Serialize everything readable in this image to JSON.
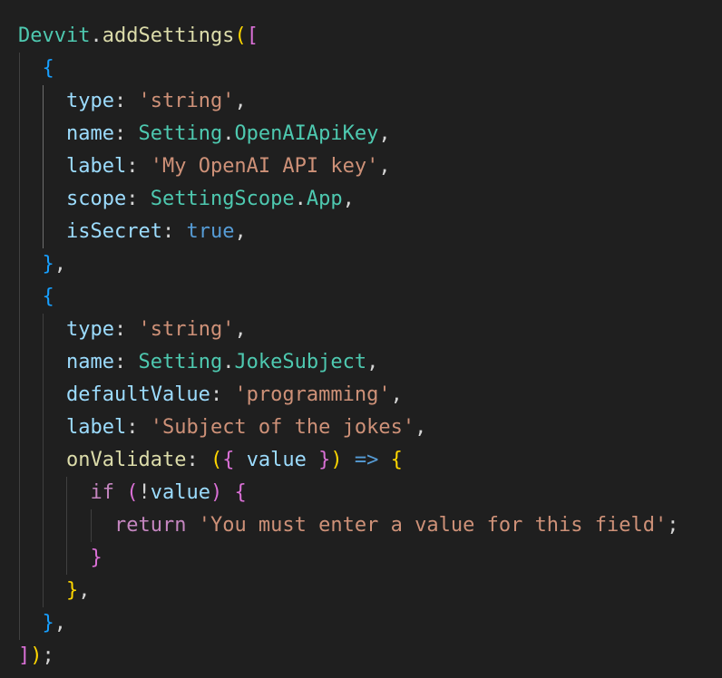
{
  "editor": {
    "language": "typescript",
    "theme": "dark",
    "colors": {
      "background": "#1f1f1f",
      "class": "#4ec9b0",
      "function": "#dcdcaa",
      "property": "#9cdcfe",
      "string": "#ce9178",
      "keyword": "#569cd6",
      "control": "#c586c0",
      "punctuation": "#d4d4d4",
      "bracket_level_1": "#ffd700",
      "bracket_level_2": "#da70d6",
      "bracket_level_3": "#179fff"
    },
    "lines": [
      [
        [
          "cls",
          "Devvit"
        ],
        [
          "punct",
          "."
        ],
        [
          "fn",
          "addSettings"
        ],
        [
          "b1",
          "("
        ],
        [
          "b2",
          "["
        ]
      ],
      [
        [
          "punct",
          "  "
        ],
        [
          "b3",
          "{"
        ]
      ],
      [
        [
          "punct",
          "    "
        ],
        [
          "prop",
          "type"
        ],
        [
          "punct",
          ": "
        ],
        [
          "str",
          "'string'"
        ],
        [
          "punct",
          ","
        ]
      ],
      [
        [
          "punct",
          "    "
        ],
        [
          "prop",
          "name"
        ],
        [
          "punct",
          ": "
        ],
        [
          "cls",
          "Setting"
        ],
        [
          "punct",
          "."
        ],
        [
          "cls",
          "OpenAIApiKey"
        ],
        [
          "punct",
          ","
        ]
      ],
      [
        [
          "punct",
          "    "
        ],
        [
          "prop",
          "label"
        ],
        [
          "punct",
          ": "
        ],
        [
          "str",
          "'My OpenAI API key'"
        ],
        [
          "punct",
          ","
        ]
      ],
      [
        [
          "punct",
          "    "
        ],
        [
          "prop",
          "scope"
        ],
        [
          "punct",
          ": "
        ],
        [
          "cls",
          "SettingScope"
        ],
        [
          "punct",
          "."
        ],
        [
          "cls",
          "App"
        ],
        [
          "punct",
          ","
        ]
      ],
      [
        [
          "punct",
          "    "
        ],
        [
          "prop",
          "isSecret"
        ],
        [
          "punct",
          ": "
        ],
        [
          "kw",
          "true"
        ],
        [
          "punct",
          ","
        ]
      ],
      [
        [
          "punct",
          "  "
        ],
        [
          "b3",
          "}"
        ],
        [
          "punct",
          ","
        ]
      ],
      [
        [
          "punct",
          "  "
        ],
        [
          "b3",
          "{"
        ]
      ],
      [
        [
          "punct",
          "    "
        ],
        [
          "prop",
          "type"
        ],
        [
          "punct",
          ": "
        ],
        [
          "str",
          "'string'"
        ],
        [
          "punct",
          ","
        ]
      ],
      [
        [
          "punct",
          "    "
        ],
        [
          "prop",
          "name"
        ],
        [
          "punct",
          ": "
        ],
        [
          "cls",
          "Setting"
        ],
        [
          "punct",
          "."
        ],
        [
          "cls",
          "JokeSubject"
        ],
        [
          "punct",
          ","
        ]
      ],
      [
        [
          "punct",
          "    "
        ],
        [
          "prop",
          "defaultValue"
        ],
        [
          "punct",
          ": "
        ],
        [
          "str",
          "'programming'"
        ],
        [
          "punct",
          ","
        ]
      ],
      [
        [
          "punct",
          "    "
        ],
        [
          "prop",
          "label"
        ],
        [
          "punct",
          ": "
        ],
        [
          "str",
          "'Subject of the jokes'"
        ],
        [
          "punct",
          ","
        ]
      ],
      [
        [
          "punct",
          "    "
        ],
        [
          "fn",
          "onValidate"
        ],
        [
          "punct",
          ": "
        ],
        [
          "b1",
          "("
        ],
        [
          "b2",
          "{"
        ],
        [
          "punct",
          " "
        ],
        [
          "prop",
          "value"
        ],
        [
          "punct",
          " "
        ],
        [
          "b2",
          "}"
        ],
        [
          "b1",
          ")"
        ],
        [
          "punct",
          " "
        ],
        [
          "kw",
          "=>"
        ],
        [
          "punct",
          " "
        ],
        [
          "b1",
          "{"
        ]
      ],
      [
        [
          "punct",
          "      "
        ],
        [
          "ctrl",
          "if"
        ],
        [
          "punct",
          " "
        ],
        [
          "b2",
          "("
        ],
        [
          "punct",
          "!"
        ],
        [
          "prop",
          "value"
        ],
        [
          "b2",
          ")"
        ],
        [
          "punct",
          " "
        ],
        [
          "b2",
          "{"
        ]
      ],
      [
        [
          "punct",
          "        "
        ],
        [
          "ctrl",
          "return"
        ],
        [
          "punct",
          " "
        ],
        [
          "str",
          "'You must enter a value for this field'"
        ],
        [
          "punct",
          ";"
        ]
      ],
      [
        [
          "punct",
          "      "
        ],
        [
          "b2",
          "}"
        ]
      ],
      [
        [
          "punct",
          "    "
        ],
        [
          "b1",
          "}"
        ],
        [
          "punct",
          ","
        ]
      ],
      [
        [
          "punct",
          "  "
        ],
        [
          "b3",
          "}"
        ],
        [
          "punct",
          ","
        ]
      ],
      [
        [
          "b2",
          "]"
        ],
        [
          "b1",
          ")"
        ],
        [
          "punct",
          ";"
        ]
      ]
    ]
  }
}
